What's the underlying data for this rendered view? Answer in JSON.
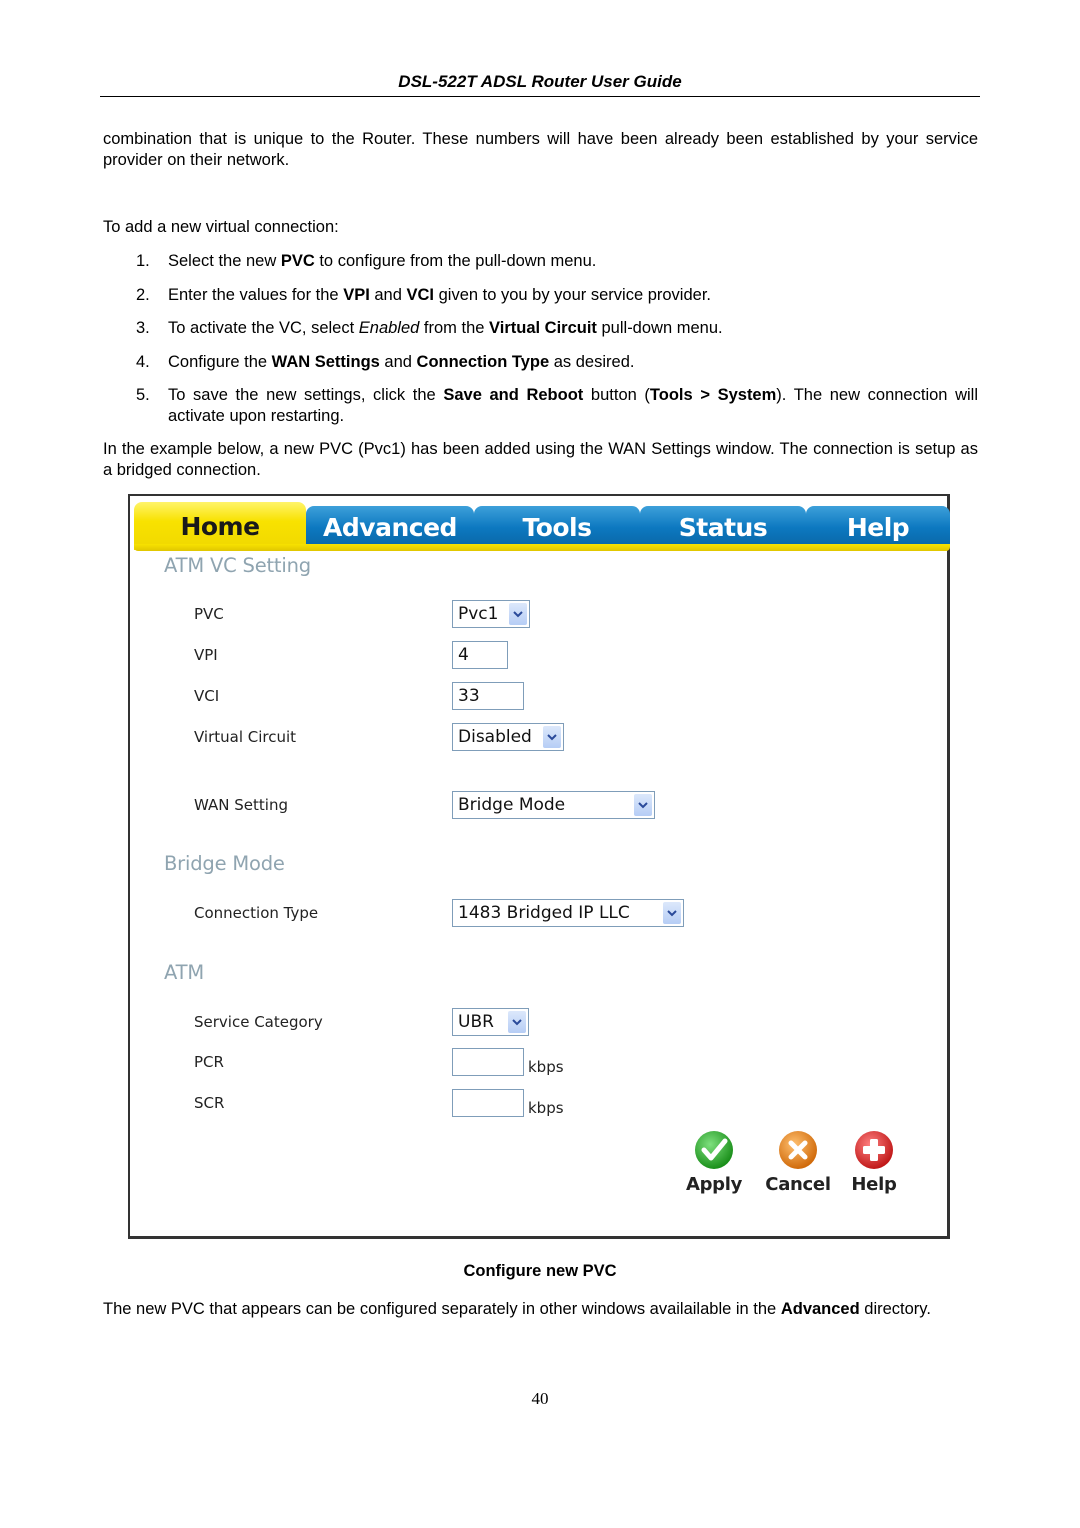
{
  "header": {
    "title": "DSL-522T ADSL Router User Guide"
  },
  "intro": {
    "p1": "combination that is unique to the Router. These numbers will have been already been established by your service provider on their network.",
    "p2": "To add a new virtual connection:"
  },
  "steps": [
    {
      "num": "1.",
      "parts": [
        [
          "Select the new ",
          ""
        ],
        [
          "PVC",
          "b"
        ],
        [
          " to configure from the pull-down menu.",
          ""
        ]
      ]
    },
    {
      "num": "2.",
      "parts": [
        [
          "Enter the values for the ",
          ""
        ],
        [
          "VPI",
          "b"
        ],
        [
          " and ",
          ""
        ],
        [
          "VCI",
          "b"
        ],
        [
          " given to you by your service provider.",
          ""
        ]
      ]
    },
    {
      "num": "3.",
      "parts": [
        [
          "To activate the VC, select ",
          ""
        ],
        [
          "Enabled",
          "i"
        ],
        [
          " from the ",
          ""
        ],
        [
          "Virtual Circuit",
          "b"
        ],
        [
          " pull-down menu.",
          ""
        ]
      ]
    },
    {
      "num": "4.",
      "parts": [
        [
          "Configure the ",
          ""
        ],
        [
          "WAN Settings",
          "b"
        ],
        [
          " and ",
          ""
        ],
        [
          "Connection Type",
          "b"
        ],
        [
          " as desired.",
          ""
        ]
      ]
    },
    {
      "num": "5.",
      "parts": [
        [
          "To save the new settings, click the ",
          ""
        ],
        [
          "Save and Reboot",
          "b"
        ],
        [
          " button (",
          ""
        ],
        [
          "Tools > System",
          "b"
        ],
        [
          "). The new connection will activate upon restarting.",
          ""
        ]
      ]
    }
  ],
  "example_text": "In the example below, a new PVC (Pvc1) has been added using the WAN Settings window. The connection is setup as a bridged connection.",
  "router_ui": {
    "tabs": [
      {
        "label": "Home",
        "active": true
      },
      {
        "label": "Advanced",
        "active": false
      },
      {
        "label": "Tools",
        "active": false
      },
      {
        "label": "Status",
        "active": false
      },
      {
        "label": "Help",
        "active": false
      }
    ],
    "sections": {
      "atm_vc": "ATM VC Setting",
      "bridge": "Bridge Mode",
      "atm": "ATM"
    },
    "fields": {
      "pvc": {
        "label": "PVC",
        "value": "Pvc1"
      },
      "vpi": {
        "label": "VPI",
        "value": "4"
      },
      "vci": {
        "label": "VCI",
        "value": "33"
      },
      "virtual_circuit": {
        "label": "Virtual Circuit",
        "value": "Disabled"
      },
      "wan_setting": {
        "label": "WAN Setting",
        "value": "Bridge Mode"
      },
      "connection_type": {
        "label": "Connection Type",
        "value": "1483 Bridged IP LLC"
      },
      "service_category": {
        "label": "Service Category",
        "value": "UBR"
      },
      "pcr": {
        "label": "PCR",
        "value": "",
        "unit": "kbps"
      },
      "scr": {
        "label": "SCR",
        "value": "",
        "unit": "kbps"
      }
    },
    "buttons": {
      "apply": {
        "label": "Apply",
        "icon": "check-icon",
        "color": "#2aa52a"
      },
      "cancel": {
        "label": "Cancel",
        "icon": "x-icon",
        "color": "#e8861a"
      },
      "help": {
        "label": "Help",
        "icon": "plus-icon",
        "color": "#d62a2a"
      }
    }
  },
  "caption": "Configure new PVC",
  "outro": [
    [
      "The new PVC that appears can be configured separately in other windows availailable in the ",
      ""
    ],
    [
      "Advanced",
      "b"
    ],
    [
      " directory.",
      ""
    ]
  ],
  "page_number": "40"
}
